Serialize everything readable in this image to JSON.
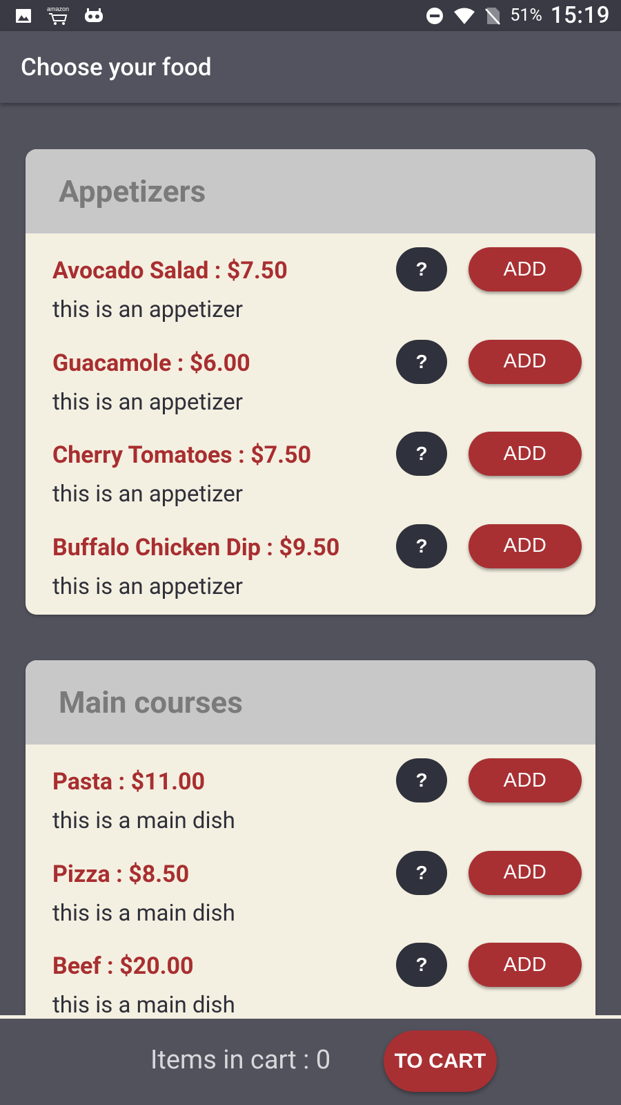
{
  "status_bar": {
    "icons_left": [
      "image-icon",
      "amazon-cart-icon",
      "cyanogen-icon"
    ],
    "amazon_label": "amazon",
    "icons_right": [
      "do-not-disturb-icon",
      "wifi-icon",
      "no-sim-icon"
    ],
    "battery": "51%",
    "time": "15:19"
  },
  "app_bar": {
    "title": "Choose your food"
  },
  "sections": [
    {
      "title": "Appetizers",
      "items": [
        {
          "name": "Avocado Salad : $7.50",
          "description": "this is an appetizer",
          "info_label": "?",
          "add_label": "ADD"
        },
        {
          "name": "Guacamole : $6.00",
          "description": "this is an appetizer",
          "info_label": "?",
          "add_label": "ADD"
        },
        {
          "name": "Cherry Tomatoes : $7.50",
          "description": "this is an appetizer",
          "info_label": "?",
          "add_label": "ADD"
        },
        {
          "name": "Buffalo Chicken Dip : $9.50",
          "description": "this is an appetizer",
          "info_label": "?",
          "add_label": "ADD"
        }
      ]
    },
    {
      "title": "Main courses",
      "items": [
        {
          "name": "Pasta : $11.00",
          "description": "this is a main dish",
          "info_label": "?",
          "add_label": "ADD"
        },
        {
          "name": "Pizza : $8.50",
          "description": "this is a main dish",
          "info_label": "?",
          "add_label": "ADD"
        },
        {
          "name": "Beef : $20.00",
          "description": "this is a main dish",
          "info_label": "?",
          "add_label": "ADD"
        }
      ]
    }
  ],
  "bottom_bar": {
    "cart_text": "Items in cart : 0",
    "to_cart_label": "TO CART"
  },
  "colors": {
    "background": "#52525d",
    "card": "#f4f0e1",
    "card_header": "#c8c8c9",
    "accent": "#a83033",
    "info_button": "#2f313c"
  }
}
